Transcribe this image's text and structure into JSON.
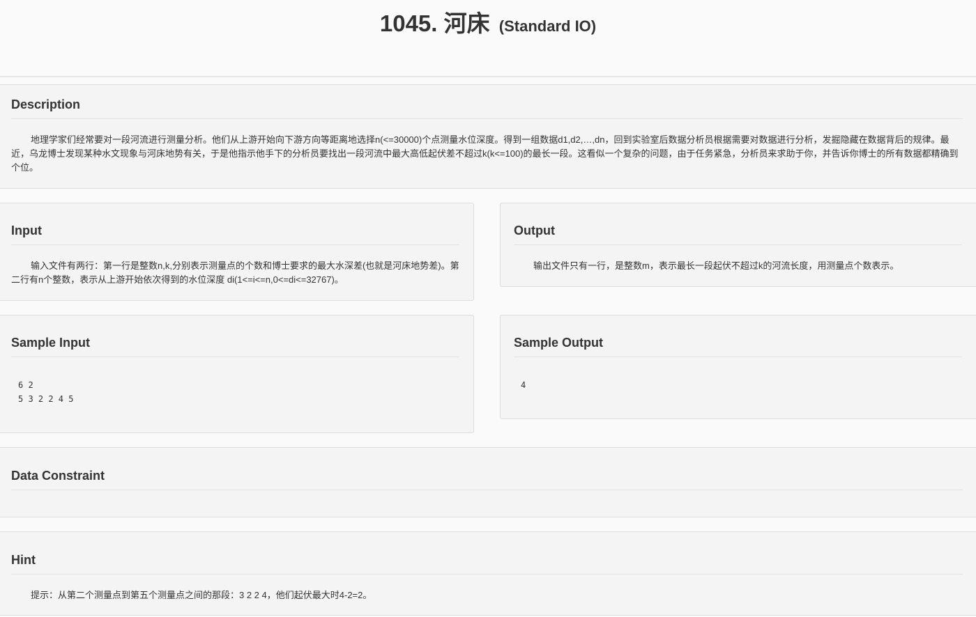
{
  "problem": {
    "number_title": "1045. 河床",
    "io_type": "(Standard IO)"
  },
  "sections": {
    "description": {
      "heading": "Description",
      "text": "地理学家们经常要对一段河流进行测量分析。他们从上游开始向下游方向等距离地选择n(<=30000)个点测量水位深度。得到一组数据d1,d2,…,dn，回到实验室后数据分析员根据需要对数据进行分析，发掘隐藏在数据背后的规律。最近，乌龙博士发现某种水文现象与河床地势有关，于是他指示他手下的分析员要找出一段河流中最大高低起伏差不超过k(k<=100)的最长一段。这看似一个复杂的问题，由于任务紧急，分析员来求助于你，并告诉你博士的所有数据都精确到个位。"
    },
    "input": {
      "heading": "Input",
      "text": "输入文件有两行：第一行是整数n,k,分别表示测量点的个数和博士要求的最大水深差(也就是河床地势差)。第二行有n个整数，表示从上游开始依次得到的水位深度 di(1<=i<=n,0<=di<=32767)。"
    },
    "output": {
      "heading": "Output",
      "text": "输出文件只有一行，是整数m，表示最长一段起伏不超过k的河流长度，用测量点个数表示。"
    },
    "sample_input": {
      "heading": "Sample Input",
      "text": "6 2\n5 3 2 2 4 5"
    },
    "sample_output": {
      "heading": "Sample Output",
      "text": "4"
    },
    "data_constraint": {
      "heading": "Data Constraint",
      "text": ""
    },
    "hint": {
      "heading": "Hint",
      "text": "提示：从第二个测量点到第五个测量点之间的那段：3 2 2 4，他们起伏最大时4-2=2。"
    }
  }
}
